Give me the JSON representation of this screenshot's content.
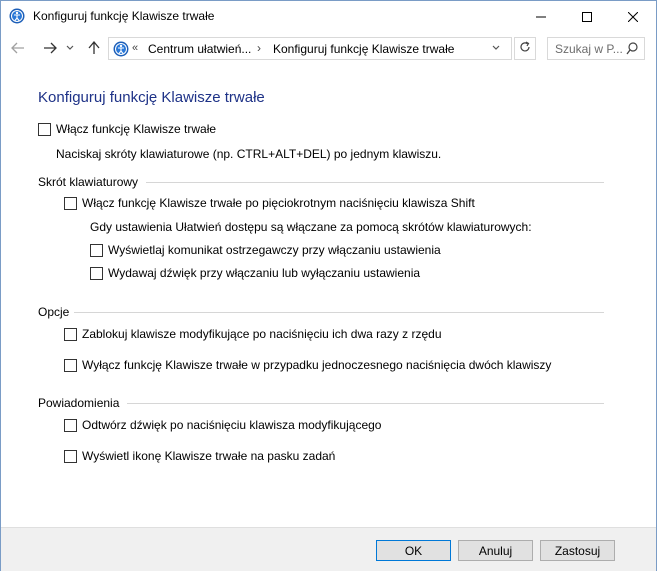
{
  "window": {
    "title": "Konfiguruj funkcję Klawisze trwałe"
  },
  "nav": {
    "breadcrumb_prefix": "«",
    "breadcrumb_1": "Centrum ułatwień...",
    "breadcrumb_sep": "›",
    "breadcrumb_2": "Konfiguruj funkcję Klawisze trwałe",
    "search_placeholder": "Szukaj w P..."
  },
  "page": {
    "title": "Konfiguruj funkcję Klawisze trwałe",
    "main_checkbox": {
      "label": "Włącz funkcję Klawisze trwałe",
      "checked": false
    },
    "main_desc": "Naciskaj skróty klawiaturowe (np. CTRL+ALT+DEL) po jednym klawiszu."
  },
  "shortcut_group": {
    "heading": "Skrót klawiaturowy",
    "enable_shift": {
      "label": "Włącz funkcję Klawisze trwałe po pięciokrotnym naciśnięciu klawisza Shift",
      "checked": false
    },
    "sub_text": "Gdy ustawienia Ułatwień dostępu są włączane za pomocą skrótów klawiaturowych:",
    "warn_msg": {
      "label": "Wyświetlaj komunikat ostrzegawczy przy włączaniu ustawienia",
      "checked": false
    },
    "sound": {
      "label": "Wydawaj dźwięk przy włączaniu lub wyłączaniu ustawienia",
      "checked": false
    }
  },
  "options_group": {
    "heading": "Opcje",
    "lock_modifiers": {
      "label": "Zablokuj klawisze modyfikujące po naciśnięciu ich dwa razy z rzędu",
      "checked": false
    },
    "disable_two_keys": {
      "label": "Wyłącz funkcję Klawisze trwałe w przypadku jednoczesnego naciśnięcia dwóch klawiszy",
      "checked": false
    }
  },
  "notify_group": {
    "heading": "Powiadomienia",
    "play_sound": {
      "label": "Odtwórz dźwięk po naciśnięciu klawisza modyfikującego",
      "checked": false
    },
    "show_icon": {
      "label": "Wyświetl ikonę Klawisze trwałe na pasku zadań",
      "checked": false
    }
  },
  "buttons": {
    "ok": "OK",
    "cancel": "Anuluj",
    "apply": "Zastosuj"
  },
  "colors": {
    "title_blue": "#1e3287",
    "ok_border": "#0078d7"
  }
}
